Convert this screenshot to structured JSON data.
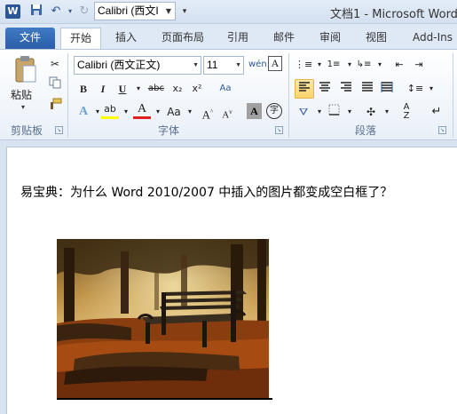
{
  "titlebar": {
    "app_icon_letter": "W",
    "qat_font": "Calibri (西文I",
    "title": "文档1 - Microsoft Word"
  },
  "tabs": [
    "文件",
    "开始",
    "插入",
    "页面布局",
    "引用",
    "邮件",
    "审阅",
    "视图",
    "Add-Ins"
  ],
  "ribbon": {
    "clipboard": {
      "paste_label": "粘贴",
      "group_label": "剪贴板"
    },
    "font": {
      "font_name": "Calibri (西文正文)",
      "font_size": "11",
      "group_label": "字体"
    },
    "paragraph": {
      "group_label": "段落"
    }
  },
  "document": {
    "line1": "易宝典：为什么 Word 2010/2007 中插入的图片都变成空白框了？"
  },
  "colors": {
    "file_tab": "#2b5ea8",
    "accent": "#2b5797",
    "highlight": "#fbd46b"
  },
  "icons": [
    "word-icon",
    "save-icon",
    "undo-icon",
    "redo-icon",
    "cut-icon",
    "copy-icon",
    "format-painter-icon",
    "bold-icon",
    "italic-icon",
    "underline-icon",
    "strikethrough-icon",
    "subscript-icon",
    "superscript-icon",
    "text-effects-icon",
    "highlight-icon",
    "font-color-icon",
    "change-case-icon",
    "grow-font-icon",
    "shrink-font-icon",
    "char-shading-icon",
    "enclose-char-icon",
    "bullets-icon",
    "numbering-icon",
    "multilevel-icon",
    "decrease-indent-icon",
    "increase-indent-icon",
    "align-left-icon",
    "center-icon",
    "align-right-icon",
    "justify-icon",
    "distributed-icon",
    "line-spacing-icon",
    "shading-icon",
    "borders-icon",
    "chinese-layout-icon",
    "sort-icon",
    "show-marks-icon"
  ]
}
